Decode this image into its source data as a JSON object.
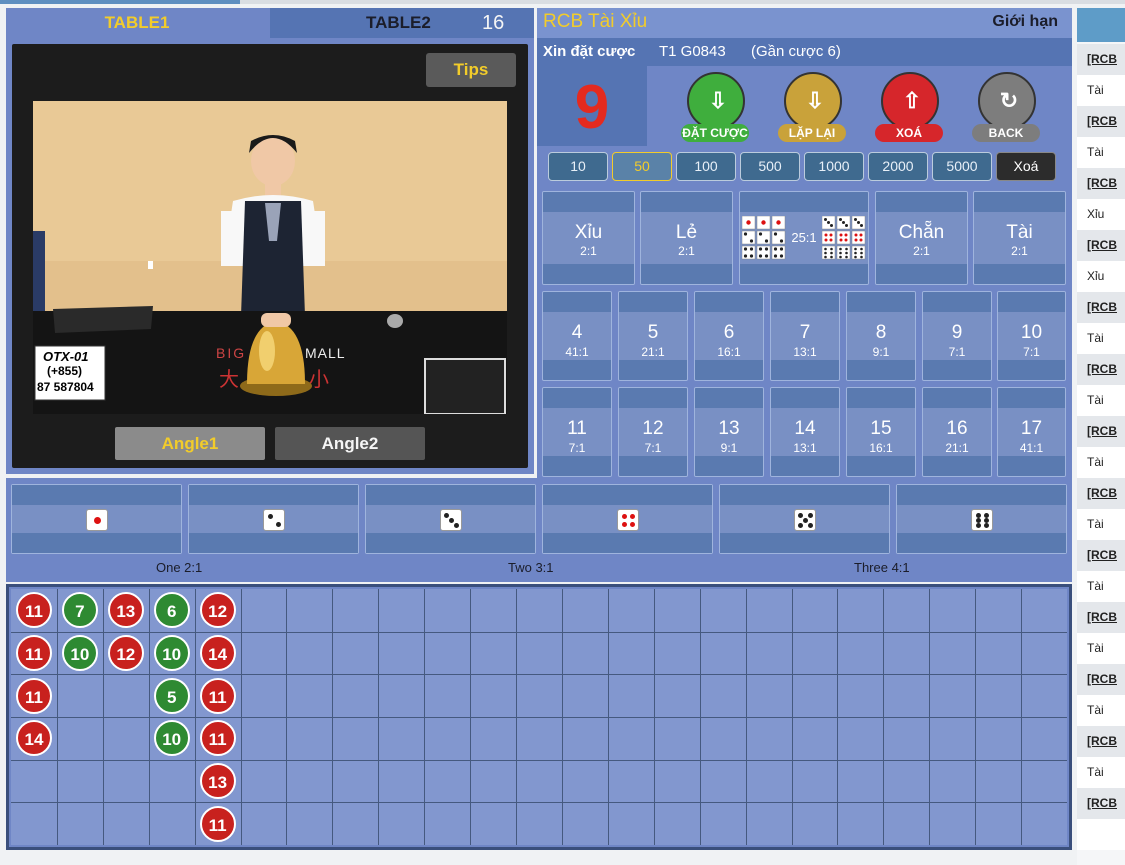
{
  "tabs": {
    "table1": "TABLE1",
    "table2": "TABLE2",
    "table2_count": "16"
  },
  "video": {
    "tips_label": "Tips",
    "angle1_label": "Angle1",
    "angle2_label": "Angle2",
    "overlay_code": "OTX-01",
    "overlay_prefix": "(+855)",
    "overlay_phone": "87 587804",
    "table_brand_left": "BIG",
    "table_brand_right": "MALL",
    "table_text_left": "大",
    "table_text_right": "小"
  },
  "game": {
    "title": "RCB Tài Xỉu",
    "limit_label": "Giới hạn",
    "status_label": "Xin đặt cược",
    "game_id": "T1 G0843",
    "round_info": "(Gần cược 6)",
    "countdown": "9"
  },
  "actions": [
    {
      "label": "ĐẶT CƯỢC",
      "icon": "place-bet-icon",
      "color": "#3fae3d"
    },
    {
      "label": "LẶP LẠI",
      "icon": "repeat-icon",
      "color": "#c9a23a"
    },
    {
      "label": "XOÁ",
      "icon": "clear-icon",
      "color": "#d6262b"
    },
    {
      "label": "BACK",
      "icon": "back-icon",
      "color": "#7d7d7d"
    }
  ],
  "chips": [
    "10",
    "50",
    "100",
    "500",
    "1000",
    "2000",
    "5000",
    "Xoá"
  ],
  "chip_selected": "50",
  "bets_top": [
    {
      "name": "Xỉu",
      "odds": "2:1"
    },
    {
      "name": "Lẻ",
      "odds": "2:1"
    },
    {
      "name": "",
      "odds": "25:1"
    },
    {
      "name": "Chẵn",
      "odds": "2:1"
    },
    {
      "name": "Tài",
      "odds": "2:1"
    }
  ],
  "bets_sum1": [
    {
      "name": "4",
      "odds": "41:1"
    },
    {
      "name": "5",
      "odds": "21:1"
    },
    {
      "name": "6",
      "odds": "16:1"
    },
    {
      "name": "7",
      "odds": "13:1"
    },
    {
      "name": "8",
      "odds": "9:1"
    },
    {
      "name": "9",
      "odds": "7:1"
    },
    {
      "name": "10",
      "odds": "7:1"
    }
  ],
  "bets_sum2": [
    {
      "name": "11",
      "odds": "7:1"
    },
    {
      "name": "12",
      "odds": "7:1"
    },
    {
      "name": "13",
      "odds": "9:1"
    },
    {
      "name": "14",
      "odds": "13:1"
    },
    {
      "name": "15",
      "odds": "16:1"
    },
    {
      "name": "16",
      "odds": "21:1"
    },
    {
      "name": "17",
      "odds": "41:1"
    }
  ],
  "single_labels": {
    "one": "One 2:1",
    "two": "Two 3:1",
    "three": "Three 4:1"
  },
  "road": [
    [
      "11",
      "7",
      "13",
      "6",
      "12"
    ],
    [
      "11",
      "10",
      "12",
      "10",
      "14"
    ],
    [
      "11",
      "",
      "",
      "5",
      "11"
    ],
    [
      "14",
      "",
      "",
      "10",
      "11"
    ],
    [
      "",
      "",
      "",
      "",
      "13"
    ],
    [
      "",
      "",
      "",
      "",
      "11"
    ]
  ],
  "road_colors": [
    [
      "red",
      "green",
      "red",
      "green",
      "red"
    ],
    [
      "red",
      "green",
      "red",
      "green",
      "red"
    ],
    [
      "red",
      "",
      "",
      "green",
      "red"
    ],
    [
      "red",
      "",
      "",
      "green",
      "red"
    ],
    [
      "",
      "",
      "",
      "",
      "red"
    ],
    [
      "",
      "",
      "",
      "",
      "red"
    ]
  ],
  "history": [
    {
      "link": "[RCB T",
      "value": "Tài"
    },
    {
      "link": "[RCB T",
      "value": "Tài"
    },
    {
      "link": "[RCB T",
      "value": "Xỉu"
    },
    {
      "link": "[RCB T",
      "value": "Xỉu"
    },
    {
      "link": "[RCB T",
      "value": "Tài"
    },
    {
      "link": "[RCB T",
      "value": "Tài"
    },
    {
      "link": "[RCB T",
      "value": "Tài"
    },
    {
      "link": "[RCB T",
      "value": "Tài"
    },
    {
      "link": "[RCB T",
      "value": "Tài"
    },
    {
      "link": "[RCB T",
      "value": "Tài"
    },
    {
      "link": "[RCB T",
      "value": "Tài"
    },
    {
      "link": "[RCB T",
      "value": "Tài"
    },
    {
      "link": "[RCB T",
      "value": ""
    }
  ]
}
